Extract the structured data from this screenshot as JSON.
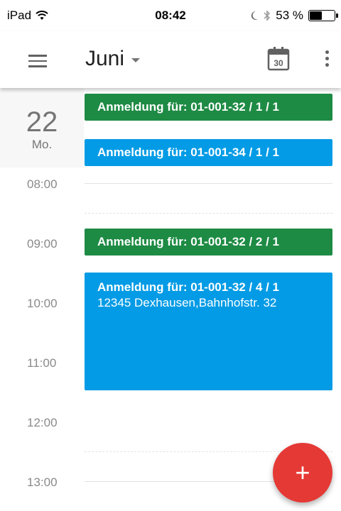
{
  "status_bar": {
    "device": "iPad",
    "time": "08:42",
    "battery_text": "53 %",
    "battery_level": 0.53
  },
  "toolbar": {
    "month": "Juni",
    "calendar_day": "30"
  },
  "day": {
    "number": "22",
    "weekday": "Mo."
  },
  "hours": [
    "08:00",
    "09:00",
    "10:00",
    "11:00",
    "12:00",
    "13:00"
  ],
  "events": [
    {
      "title": "Anmeldung für: 01-001-32 / 1 / 1",
      "color": "#1e8b44"
    },
    {
      "title": "Anmeldung für: 01-001-34 / 1 / 1",
      "color": "#039be5"
    },
    {
      "title": "Anmeldung für: 01-001-32 / 2 / 1",
      "color": "#1e8b44"
    },
    {
      "title": "Anmeldung für: 01-001-32 / 4 / 1",
      "subtitle": "12345 Dexhausen,Bahnhofstr. 32",
      "color": "#039be5"
    }
  ],
  "fab": {
    "label": "+",
    "color": "#e53935"
  }
}
